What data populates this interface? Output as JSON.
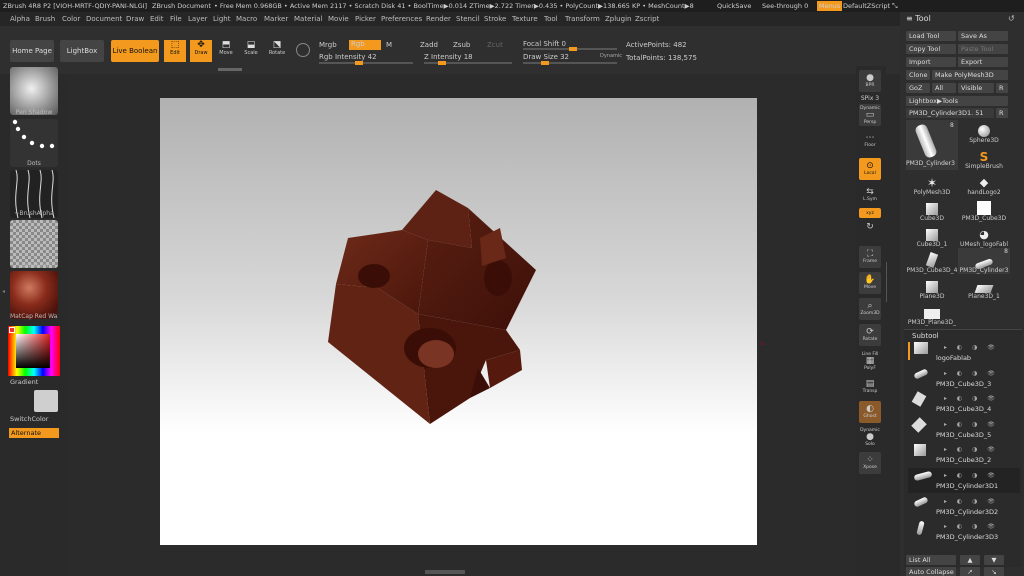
{
  "titlebar": {
    "app": "ZBrush 4R8 P2 [VIOH-MRTF-QDIY-PANI-NLGI]",
    "doc": "ZBrush Document",
    "stats": "• Free Mem 0.968GB • Active Mem 2117 • Scratch Disk 41 • BoolTime▶0.014 ZTime▶2.722 Timer▶0.435 • PolyCount▶138.665 KP • MeshCount▶8",
    "quicksave": "QuickSave",
    "seethrough": "See-through  0",
    "menus": "Menus",
    "script": "DefaultZScript"
  },
  "menubar": [
    "Alpha",
    "Brush",
    "Color",
    "Document",
    "Draw",
    "Edit",
    "File",
    "Layer",
    "Light",
    "Macro",
    "Marker",
    "Material",
    "Movie",
    "Picker",
    "Preferences",
    "Render",
    "Stencil",
    "Stroke",
    "Texture",
    "Tool",
    "Transform",
    "Zplugin",
    "Zscript"
  ],
  "toolbar": {
    "home": "Home Page",
    "lightbox": "LightBox",
    "liveboolean": "Live Boolean",
    "edit": "Edit",
    "draw": "Draw",
    "move": "Move",
    "scale": "Scale",
    "rotate": "Rotate",
    "mrgb": "Mrgb",
    "rgb": "Rgb",
    "m": "M",
    "rgb_intensity": "Rgb Intensity 42",
    "rgb_intensity_value": 42,
    "zadd": "Zadd",
    "zsub": "Zsub",
    "zcut": "Zcut",
    "z_intensity": "Z Intensity 18",
    "z_intensity_value": 18,
    "focal_shift": "Focal Shift 0",
    "draw_size": "Draw Size 32",
    "dynamic": "Dynamic",
    "active_points": "ActivePoints: 482",
    "total_points": "TotalPoints: 138,575"
  },
  "leftshelf": {
    "brush": "Pen Shadow",
    "stroke": "Dots",
    "alpha": "~BrushAlpha",
    "texture": "~BrushTxtr",
    "material": "MatCap Red Wax",
    "gradient": "Gradient",
    "switchcolor": "SwitchColor",
    "alternate": "Alternate"
  },
  "rightshelf": {
    "bpr": "BPR",
    "spix": "SPix 3",
    "dynamic_persp": "Dynamic",
    "persp": "Persp",
    "floor": "Floor",
    "local": "Local",
    "lsym": "L.Sym",
    "xyz": "xyz",
    "frame": "Frame",
    "move": "Move",
    "zoom3d": "Zoom3D",
    "rotate": "Rotate",
    "linefill": "Line Fill",
    "polyf": "PolyF",
    "transp": "Transp",
    "ghost": "Ghost",
    "dynamic_solo": "Dynamic",
    "solo": "Solo",
    "xpose": "Xpose"
  },
  "toolpanel": {
    "title": "Tool",
    "load": "Load Tool",
    "saveas": "Save As",
    "copy": "Copy Tool",
    "paste": "Paste Tool",
    "import": "Import",
    "export": "Export",
    "clone": "Clone",
    "makepm": "Make PolyMesh3D",
    "goz": "GoZ",
    "all": "All",
    "visible": "Visible",
    "r": "R",
    "lightbox_tools": "Lightbox▶Tools",
    "current": "PM3D_Cylinder3D1. 51",
    "tools": [
      {
        "name": "PM3D_Cylinder3",
        "badge": "8"
      },
      {
        "name": "Sphere3D",
        "badge": ""
      },
      {
        "name": "SimpleBrush",
        "badge": ""
      },
      {
        "name": "PolyMesh3D",
        "badge": ""
      },
      {
        "name": "handLogo2",
        "badge": ""
      },
      {
        "name": "Cube3D",
        "badge": ""
      },
      {
        "name": "PM3D_Cube3D",
        "badge": ""
      },
      {
        "name": "Cube3D_1",
        "badge": ""
      },
      {
        "name": "UMesh_logoFabl",
        "badge": ""
      },
      {
        "name": "PM3D_Cube3D_4",
        "badge": ""
      },
      {
        "name": "PM3D_Cylinder3",
        "badge": "8"
      },
      {
        "name": "Plane3D",
        "badge": ""
      },
      {
        "name": "Plane3D_1",
        "badge": ""
      },
      {
        "name": "PM3D_Plane3D_",
        "badge": ""
      }
    ],
    "subtool": "Subtool",
    "subtools": [
      "logoFablab",
      "PM3D_Cube3D_3",
      "PM3D_Cube3D_4",
      "PM3D_Cube3D_5",
      "PM3D_Cube3D_2",
      "PM3D_Cylinder3D1",
      "PM3D_Cylinder3D2",
      "PM3D_Cylinder3D3"
    ],
    "listall": "List All",
    "autocollapse": "Auto Collapse"
  },
  "colors": {
    "accent": "#f39a1e",
    "material": "#6a2516"
  }
}
